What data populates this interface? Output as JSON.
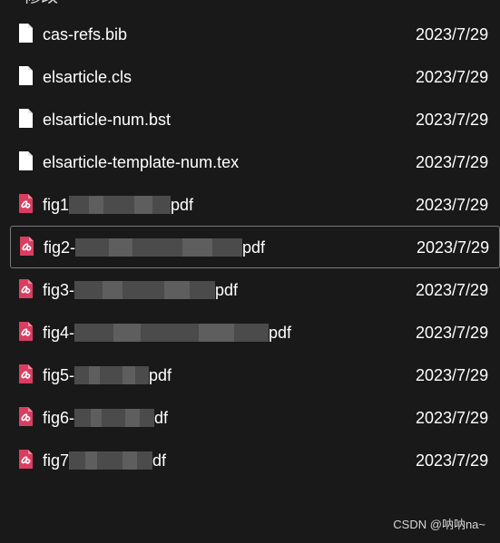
{
  "header": {
    "fragment": "修改"
  },
  "files": [
    {
      "name": "cas-refs.bib",
      "date": "2023/7/29",
      "icon": "document-file-icon",
      "selected": false
    },
    {
      "name": "elsarticle.cls",
      "date": "2023/7/29",
      "icon": "document-file-icon",
      "selected": false
    },
    {
      "name": "elsarticle-num.bst",
      "date": "2023/7/29",
      "icon": "document-file-icon",
      "selected": false
    },
    {
      "name": "elsarticle-template-num.tex",
      "date": "2023/7/29",
      "icon": "document-file-icon",
      "selected": false
    },
    {
      "name_start": "fig1",
      "name_ext": "pdf",
      "date": "2023/7/29",
      "icon": "pdf-file-icon",
      "selected": false,
      "redacted": true
    },
    {
      "name_start": "fig2-",
      "name_ext": "pdf",
      "date": "2023/7/29",
      "icon": "pdf-file-icon",
      "selected": true,
      "redacted": true
    },
    {
      "name_start": "fig3-",
      "name_ext": "pdf",
      "date": "2023/7/29",
      "icon": "pdf-file-icon",
      "selected": false,
      "redacted": true
    },
    {
      "name_start": "fig4-",
      "name_ext": "pdf",
      "date": "2023/7/29",
      "icon": "pdf-file-icon",
      "selected": false,
      "redacted": true
    },
    {
      "name_start": "fig5-",
      "name_ext": "pdf",
      "date": "2023/7/29",
      "icon": "pdf-file-icon",
      "selected": false,
      "redacted": true
    },
    {
      "name_start": "fig6-",
      "name_ext": "df",
      "date": "2023/7/29",
      "icon": "pdf-file-icon",
      "selected": false,
      "redacted": true
    },
    {
      "name_start": "fig7",
      "name_ext": "df",
      "date": "2023/7/29",
      "icon": "pdf-file-icon",
      "selected": false,
      "redacted": true
    }
  ],
  "watermark": {
    "text": "CSDN @呐呐na~"
  },
  "colors": {
    "background": "#191919",
    "text": "#ffffff",
    "selection_border": "#7a7a7a",
    "pdf_icon": "#d93e61"
  }
}
